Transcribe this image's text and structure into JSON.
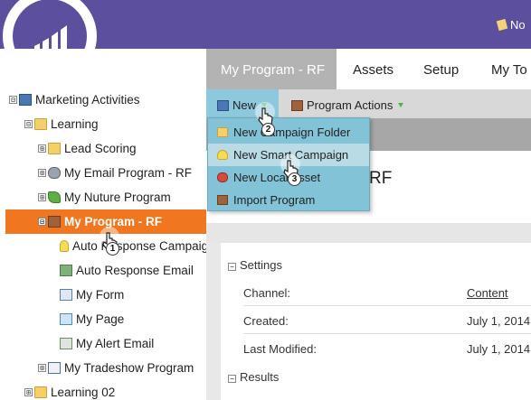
{
  "top_bar": {
    "right_text": "No"
  },
  "tree": {
    "items": [
      {
        "label": "Marketing Activities",
        "expander": "⊟",
        "icon": "marketing-activities-icon"
      },
      {
        "label": "Learning",
        "expander": "⊟",
        "icon": "folder-icon"
      },
      {
        "label": "Lead Scoring",
        "expander": "⊞",
        "icon": "folder-icon"
      },
      {
        "label": "My Email Program - RF",
        "expander": "⊞",
        "icon": "email-program-icon"
      },
      {
        "label": "My Nuture Program",
        "expander": "⊞",
        "icon": "nurture-program-icon"
      },
      {
        "label": "My Program - RF",
        "expander": "⊟",
        "icon": "program-icon",
        "selected": true
      },
      {
        "label": "Auto Response Campaign",
        "icon": "smart-campaign-icon"
      },
      {
        "label": "Auto Response Email",
        "icon": "email-icon"
      },
      {
        "label": "My Form",
        "icon": "form-icon"
      },
      {
        "label": "My Page",
        "icon": "landing-page-icon"
      },
      {
        "label": "My Alert Email",
        "icon": "alert-email-icon"
      },
      {
        "label": "My Tradeshow Program",
        "expander": "⊞",
        "icon": "event-program-icon"
      },
      {
        "label": "Learning 02",
        "expander": "⊞",
        "icon": "folder-icon"
      }
    ]
  },
  "tabs": [
    {
      "label": "My Program - RF",
      "active": true
    },
    {
      "label": "Assets"
    },
    {
      "label": "Setup"
    },
    {
      "label": "My To"
    }
  ],
  "toolbar": {
    "new_label": "New",
    "program_actions_label": "Program Actions"
  },
  "dropdown": {
    "items": [
      {
        "label": "New Campaign Folder",
        "icon": "folder-icon"
      },
      {
        "label": "New Smart Campaign",
        "icon": "smart-campaign-icon",
        "hover": true
      },
      {
        "label": "New Local Asset",
        "icon": "local-asset-icon"
      },
      {
        "label": "Import Program",
        "icon": "import-program-icon"
      }
    ]
  },
  "heading": {
    "title": "RF"
  },
  "settings": {
    "section_label": "Settings",
    "rows": [
      {
        "label": "Channel:",
        "value": "Content",
        "link": true
      },
      {
        "label": "Created:",
        "value": "July 1, 2014"
      },
      {
        "label": "Last Modified:",
        "value": "July 1, 2014"
      }
    ],
    "results_label": "Results"
  },
  "steps": [
    "1",
    "2",
    "3"
  ],
  "colors": {
    "brand_purple": "#5b4f9e",
    "selected_orange": "#f0771f",
    "menu_blue": "#83c3d8",
    "menu_hover": "#b9dbe6",
    "tab_active_gray": "#b3b3b3"
  }
}
